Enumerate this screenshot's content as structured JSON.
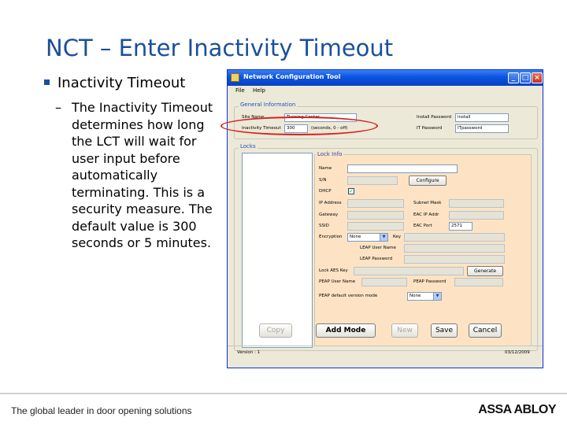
{
  "slide": {
    "title": "NCT – Enter Inactivity Timeout",
    "bullet": "Inactivity Timeout",
    "subbullet_dash": "–",
    "subbullet": "The Inactivity Timeout determines how long the LCT will wait for user input before automatically terminating. This is a security measure. The default value is 300 seconds or 5 minutes."
  },
  "window": {
    "title": "Network Configuration Tool",
    "minimize": "_",
    "maximize": "□",
    "close": "×",
    "menu": [
      "File",
      "Help"
    ],
    "general": {
      "label": "General Information",
      "site_name_label": "Site Name",
      "site_name_value": "Training Center",
      "inactivity_label": "Inactivity Timeout",
      "inactivity_value": "300",
      "inactivity_hint": "(seconds, 0 - off)",
      "install_pw_label": "Install Password",
      "install_pw_value": "install",
      "it_pw_label": "IT Password",
      "it_pw_value": "ITpassword"
    },
    "locks_label": "Locks",
    "lock_info": {
      "label": "Lock Info",
      "name_label": "Name",
      "sn_label": "S/N",
      "configure_button": "Configure",
      "dhcp_label": "DHCP",
      "dhcp_check": "✓",
      "ip_label": "IP Address",
      "subnet_label": "Subnet Mask",
      "gateway_label": "Gateway",
      "eac_ip_label": "EAC IP Addr",
      "ssid_label": "SSID",
      "eac_port_label": "EAC Port",
      "eac_port_value": "2571",
      "encryption_label": "Encryption",
      "encryption_value": "None",
      "key_label": "Key",
      "leap_user_label": "LEAP User Name",
      "leap_pw_label": "LEAP Password",
      "aes_label": "Lock AES Key",
      "generate_button": "Generate",
      "peap_user_label": "PEAP User Name",
      "peap_pw_label": "PEAP Password",
      "peap_ver_label": "PEAP default version mode",
      "peap_ver_value": "None"
    },
    "buttons": {
      "copy": "Copy",
      "add_mode": "Add Mode",
      "new": "New",
      "save": "Save",
      "cancel": "Cancel"
    },
    "status": {
      "version": "Version : 1",
      "date": "03/12/2009"
    }
  },
  "footer": {
    "tagline": "The global leader in door opening solutions",
    "brand": "ASSA ABLOY"
  },
  "colors": {
    "title_blue": "#1a4f9c",
    "highlight_red": "#d9201f",
    "lock_info_bg": "#fde3c3"
  }
}
